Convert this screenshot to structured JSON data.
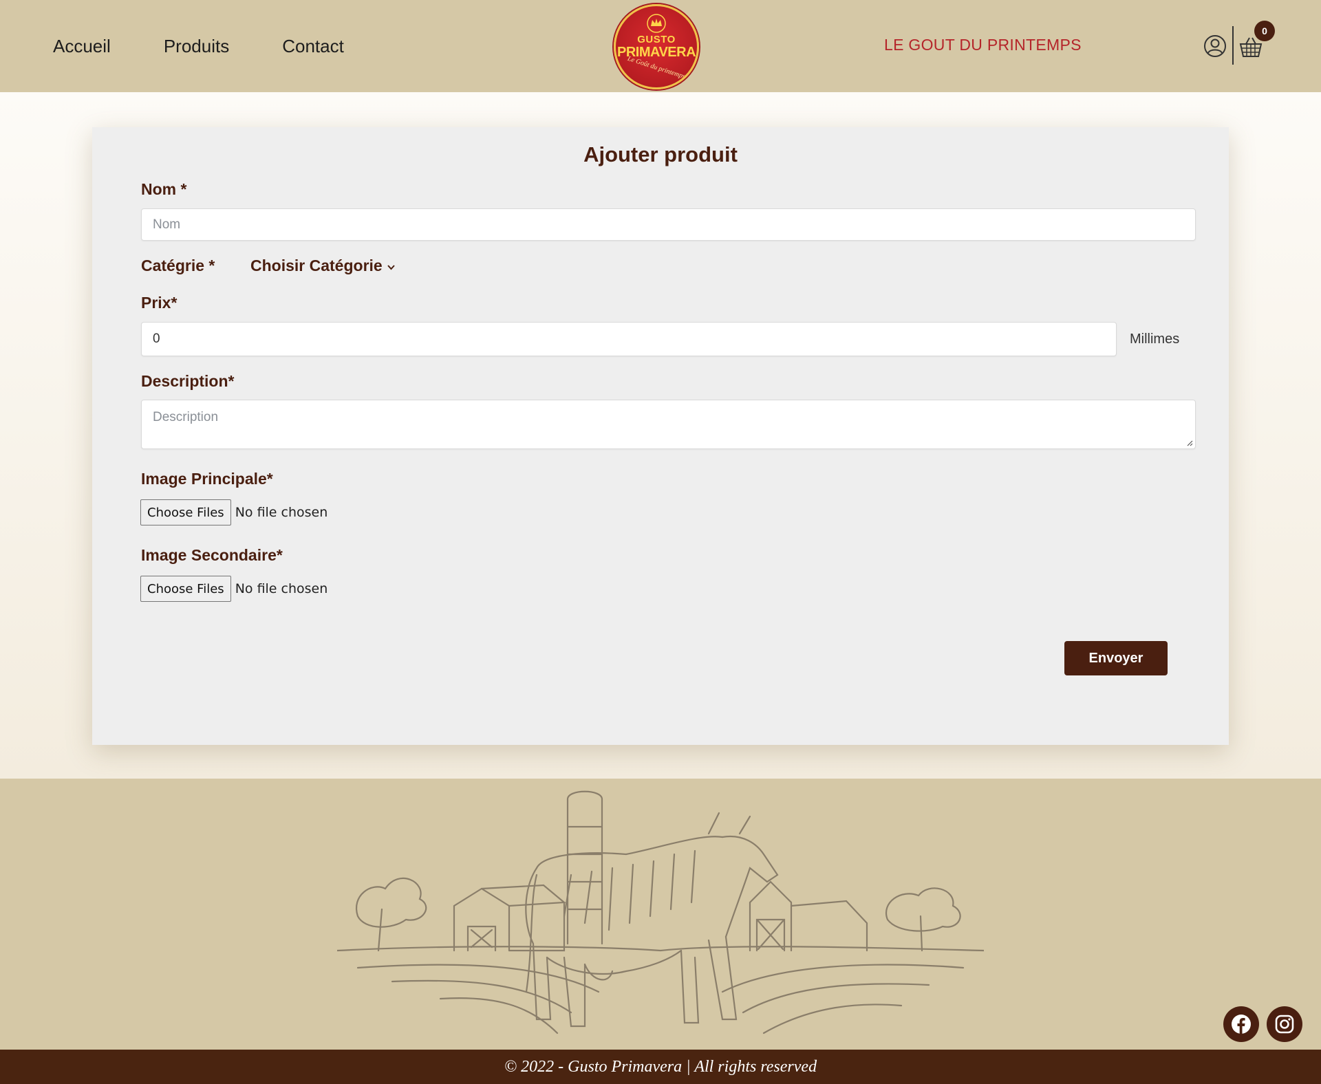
{
  "header": {
    "nav": [
      "Accueil",
      "Produits",
      "Contact"
    ],
    "logo": {
      "line1": "GUSTO",
      "line2": "PRIMAVERA",
      "line3": "Le Goût du printemps"
    },
    "tagline": "LE GOUT DU PRINTEMPS",
    "cart_count": "0",
    "icons": [
      "user-circle-icon",
      "basket-icon"
    ]
  },
  "form": {
    "title": "Ajouter produit",
    "name_label": "Nom *",
    "name_placeholder": "Nom",
    "category_label": "Catégrie *",
    "category_select": "Choisir Catégorie",
    "price_label": "Prix*",
    "price_value": "0",
    "price_unit": "Millimes",
    "description_label": "Description*",
    "description_placeholder": "Description",
    "main_image_label": "Image Principale*",
    "secondary_image_label": "Image Secondaire*",
    "file_button": "Choose Files",
    "file_status": "No file chosen",
    "submit_label": "Envoyer"
  },
  "footer": {
    "social": [
      "facebook-icon",
      "instagram-icon"
    ],
    "copyright": "© 2022 - Gusto Primavera | All rights reserved"
  },
  "colors": {
    "header_bg": "#d5c8a6",
    "brand_brown": "#4a1f10",
    "tagline_red": "#b5252a",
    "card_bg": "#eeeeee"
  }
}
